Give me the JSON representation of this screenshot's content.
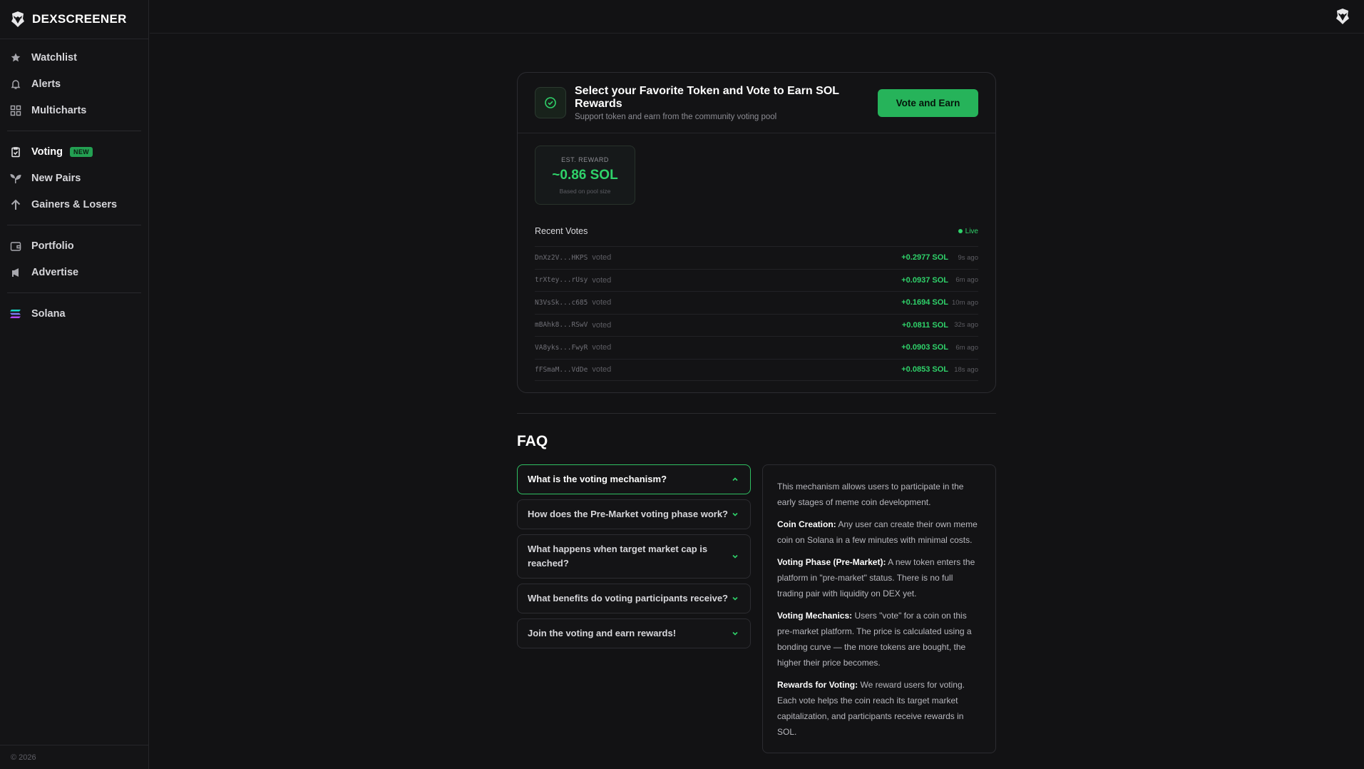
{
  "brand": {
    "name": "DEXSCREENER",
    "logo_icon": "dexscreener-logo-icon"
  },
  "sidebar": {
    "groups": [
      [
        {
          "label": "Watchlist",
          "icon": "star-icon"
        },
        {
          "label": "Alerts",
          "icon": "bell-icon"
        },
        {
          "label": "Multicharts",
          "icon": "grid-icon"
        }
      ],
      [
        {
          "label": "Voting",
          "icon": "clipboard-check-icon",
          "badge": "NEW"
        },
        {
          "label": "New Pairs",
          "icon": "sprout-icon"
        },
        {
          "label": "Gainers & Losers",
          "icon": "arrow-up-icon"
        }
      ],
      [
        {
          "label": "Portfolio",
          "icon": "wallet-icon"
        },
        {
          "label": "Advertise",
          "icon": "megaphone-icon"
        }
      ],
      [
        {
          "label": "Solana",
          "icon": "solana-icon"
        }
      ]
    ],
    "footer": "© 2026"
  },
  "topbar": {
    "avatar_icon": "dexscreener-logo-icon"
  },
  "voting": {
    "title": "Select your Favorite Token and Vote to Earn SOL Rewards",
    "subtitle": "Support token and earn from the community voting pool",
    "button": "Vote and Earn",
    "reward": {
      "label": "EST. REWARD",
      "value": "~0.86 SOL",
      "note": "Based on pool size"
    },
    "recent_title": "Recent Votes",
    "live_label": "Live",
    "votes": [
      {
        "addr": "DnXz2V...HKPS",
        "action": "voted",
        "amount": "+0.2977 SOL",
        "ago": "9s ago"
      },
      {
        "addr": "trXtey...rUsy",
        "action": "voted",
        "amount": "+0.0937 SOL",
        "ago": "6m ago"
      },
      {
        "addr": "N3VsSk...c685",
        "action": "voted",
        "amount": "+0.1694 SOL",
        "ago": "10m ago"
      },
      {
        "addr": "mBAhk8...RSwV",
        "action": "voted",
        "amount": "+0.0811 SOL",
        "ago": "32s ago"
      },
      {
        "addr": "VA8yks...FwyR",
        "action": "voted",
        "amount": "+0.0903 SOL",
        "ago": "6m ago"
      },
      {
        "addr": "fFSmaM...VdDe",
        "action": "voted",
        "amount": "+0.0853 SOL",
        "ago": "18s ago"
      }
    ]
  },
  "faq": {
    "title": "FAQ",
    "questions": [
      {
        "q": "What is the voting mechanism?",
        "open": true
      },
      {
        "q": "How does the Pre-Market voting phase work?",
        "open": false
      },
      {
        "q": "What happens when target market cap is reached?",
        "open": false
      },
      {
        "q": "What benefits do voting participants receive?",
        "open": false
      },
      {
        "q": "Join the voting and earn rewards!",
        "open": false
      }
    ],
    "answer": [
      {
        "bold": "",
        "text": "This mechanism allows users to participate in the early stages of meme coin development."
      },
      {
        "bold": "Coin Creation:",
        "text": " Any user can create their own meme coin on Solana in a few minutes with minimal costs."
      },
      {
        "bold": "Voting Phase (Pre-Market):",
        "text": " A new token enters the platform in \"pre-market\" status. There is no full trading pair with liquidity on DEX yet."
      },
      {
        "bold": "Voting Mechanics:",
        "text": " Users \"vote\" for a coin on this pre-market platform. The price is calculated using a bonding curve — the more tokens are bought, the higher their price becomes."
      },
      {
        "bold": "Rewards for Voting:",
        "text": " We reward users for voting. Each vote helps the coin reach its target market capitalization, and participants receive rewards in SOL."
      }
    ]
  },
  "colors": {
    "accent": "#2fd26a",
    "button": "#26b35a",
    "background": "#121214"
  }
}
